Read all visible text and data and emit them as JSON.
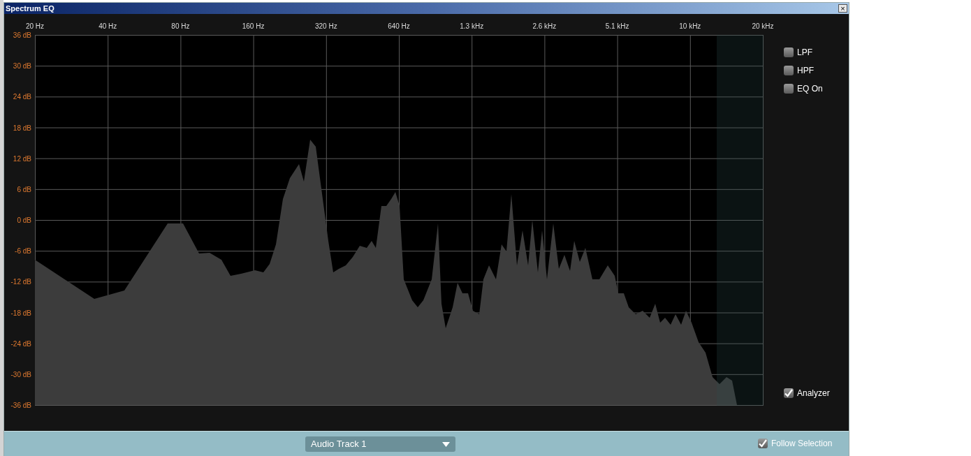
{
  "window": {
    "title": "Spectrum EQ",
    "close_glyph": "×"
  },
  "frequency_labels": [
    "20 Hz",
    "40 Hz",
    "80 Hz",
    "160 Hz",
    "320 Hz",
    "640 Hz",
    "1.3 kHz",
    "2.6 kHz",
    "5.1 kHz",
    "10 kHz",
    "20 kHz"
  ],
  "db_labels": [
    "36 dB",
    "30 dB",
    "24 dB",
    "18 dB",
    "12 dB",
    "6 dB",
    "0 dB",
    "-6 dB",
    "-12 dB",
    "-18 dB",
    "-24 dB",
    "-30 dB",
    "-36 dB"
  ],
  "filters": [
    {
      "label": "LPF",
      "checked": false
    },
    {
      "label": "HPF",
      "checked": false
    },
    {
      "label": "EQ On",
      "checked": false
    }
  ],
  "analyzer": {
    "label": "Analyzer",
    "checked": true
  },
  "track_select": {
    "value": "Audio Track 1"
  },
  "follow_selection": {
    "label": "Follow Selection",
    "checked": true
  }
}
